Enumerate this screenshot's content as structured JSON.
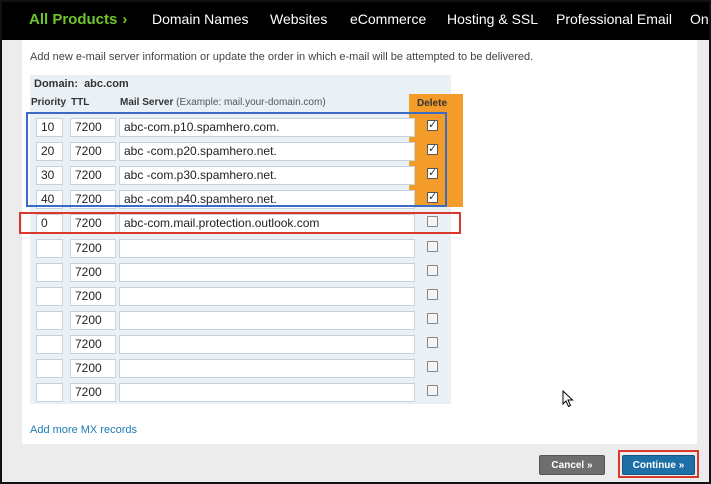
{
  "nav": {
    "all_products": "All Products",
    "items": [
      "Domain Names",
      "Websites",
      "eCommerce",
      "Hosting & SSL",
      "Professional Email",
      "On"
    ]
  },
  "intro_text": "Add new e-mail server information or update the order in which e-mail will be attempted to be delivered.",
  "domain": {
    "label": "Domain:",
    "value": "abc.com"
  },
  "columns": {
    "priority": "Priority",
    "ttl": "TTL",
    "server": "Mail Server",
    "server_example": "(Example: mail.your-domain.com)",
    "delete": "Delete"
  },
  "rows": [
    {
      "priority": "10",
      "ttl": "7200",
      "server": "abc-com.p10.spamhero.com.",
      "delete": true
    },
    {
      "priority": "20",
      "ttl": "7200",
      "server": "abc -com.p20.spamhero.net.",
      "delete": true
    },
    {
      "priority": "30",
      "ttl": "7200",
      "server": "abc -com.p30.spamhero.net.",
      "delete": true
    },
    {
      "priority": "40",
      "ttl": "7200",
      "server": "abc -com.p40.spamhero.net.",
      "delete": true
    },
    {
      "priority": "0",
      "ttl": "7200",
      "server": "abc-com.mail.protection.outlook.com",
      "delete": false
    },
    {
      "priority": "",
      "ttl": "7200",
      "server": "",
      "delete": false
    },
    {
      "priority": "",
      "ttl": "7200",
      "server": "",
      "delete": false
    },
    {
      "priority": "",
      "ttl": "7200",
      "server": "",
      "delete": false
    },
    {
      "priority": "",
      "ttl": "7200",
      "server": "",
      "delete": false
    },
    {
      "priority": "",
      "ttl": "7200",
      "server": "",
      "delete": false
    },
    {
      "priority": "",
      "ttl": "7200",
      "server": "",
      "delete": false
    },
    {
      "priority": "",
      "ttl": "7200",
      "server": "",
      "delete": false
    }
  ],
  "add_more": "Add more MX records",
  "buttons": {
    "cancel": "Cancel »",
    "continue": "Continue »"
  },
  "colors": {
    "nav_bg": "#000000",
    "nav_accent": "#6fc52e",
    "highlight_blue": "#3a6cc6",
    "highlight_red": "#d9382b",
    "highlight_orange": "#f39c2a",
    "continue_blue": "#1d6fa6"
  }
}
